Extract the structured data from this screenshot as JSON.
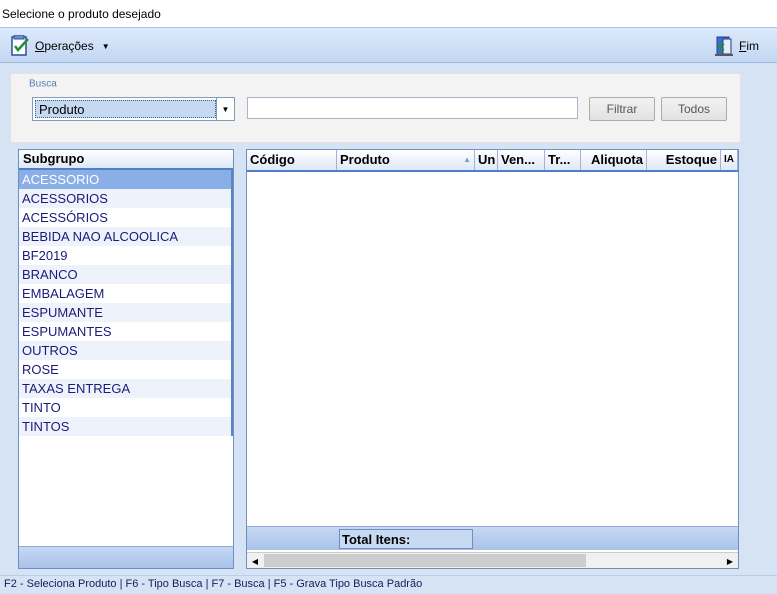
{
  "window": {
    "title": "Selecione o produto desejado"
  },
  "toolbar": {
    "operacoes_label": "Operações",
    "fim_label": "Fim"
  },
  "busca": {
    "legend": "Busca",
    "search_type": "Produto",
    "search_value": "",
    "filter_label": "Filtrar",
    "all_label": "Todos"
  },
  "subgroup": {
    "header": "Subgrupo",
    "items": [
      "ACESSORIO",
      "ACESSORIOS",
      "ACESSÓRIOS",
      "BEBIDA NAO ALCOOLICA",
      "BF2019",
      "BRANCO",
      "EMBALAGEM",
      "ESPUMANTE",
      "ESPUMANTES",
      "OUTROS",
      "ROSE",
      "TAXAS ENTREGA",
      "TINTO",
      "TINTOS"
    ],
    "selected_index": 0
  },
  "products": {
    "columns": [
      "Código",
      "Produto",
      "Un",
      "Ven...",
      "Tr...",
      "Aliquota",
      "Estoque",
      "IA"
    ],
    "total_label": "Total Itens:"
  },
  "statusbar": {
    "text": "F2 - Seleciona Produto  |  F6 - Tipo Busca  |  F7 - Busca |  F5 - Grava Tipo Busca Padrão"
  },
  "colors": {
    "accent": "#4f7fc6",
    "selection": "#8aaee6",
    "list_text": "#1a1a7a"
  },
  "icons": {
    "operacoes": "checklist-icon",
    "fim": "exit-door-icon"
  }
}
